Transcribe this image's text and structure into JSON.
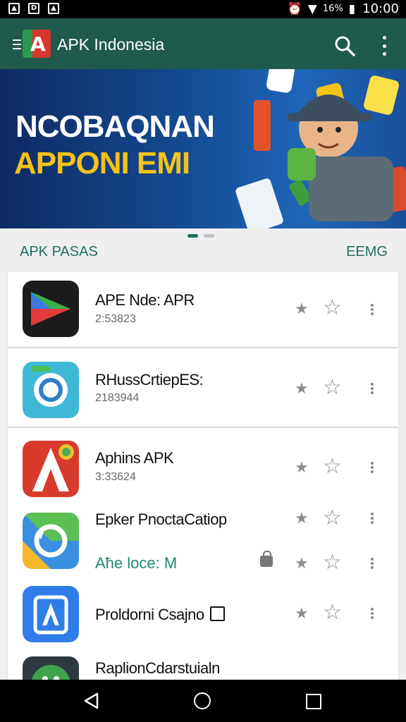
{
  "status_bar": {
    "battery": "16%",
    "time": "10:00"
  },
  "app_bar": {
    "title": "APK Indonesia",
    "icons": [
      "menu-icon",
      "app-logo",
      "search-icon",
      "more-vert-icon"
    ]
  },
  "banner": {
    "headline": "NCOBAQNAN",
    "subheadline": "APPONI EMI",
    "dots": {
      "count": 2,
      "active": 1
    }
  },
  "section": {
    "title": "APK PASAS",
    "action": "EEMG"
  },
  "apps": [
    {
      "name": "APE Nde: APR",
      "meta": "2:53823",
      "icon": "play-triangle-icon"
    },
    {
      "name": "RHussCrtiepES:",
      "meta": "2183944",
      "icon": "gear-icon"
    },
    {
      "name": "Aphins APK",
      "meta": "3:33624",
      "icon": "letter-a-icon"
    },
    {
      "name": "Epker PnoctaCatiop",
      "meta": "Aħe loce: M",
      "icon": "refresh-icon"
    },
    {
      "name": "Proldorni Csajno",
      "meta": "",
      "icon": "app-store-icon"
    },
    {
      "name": "RaplionCdarstuialn",
      "meta": "",
      "icon": "android-icon"
    }
  ],
  "colors": {
    "app_bar": "#1f5a4c",
    "accent": "#1f6d62",
    "banner_title": "#ffffff",
    "banner_subtitle": "#f4c21a"
  },
  "nav_bar": {
    "icons": [
      "back-icon",
      "home-icon",
      "recent-apps-icon"
    ]
  }
}
